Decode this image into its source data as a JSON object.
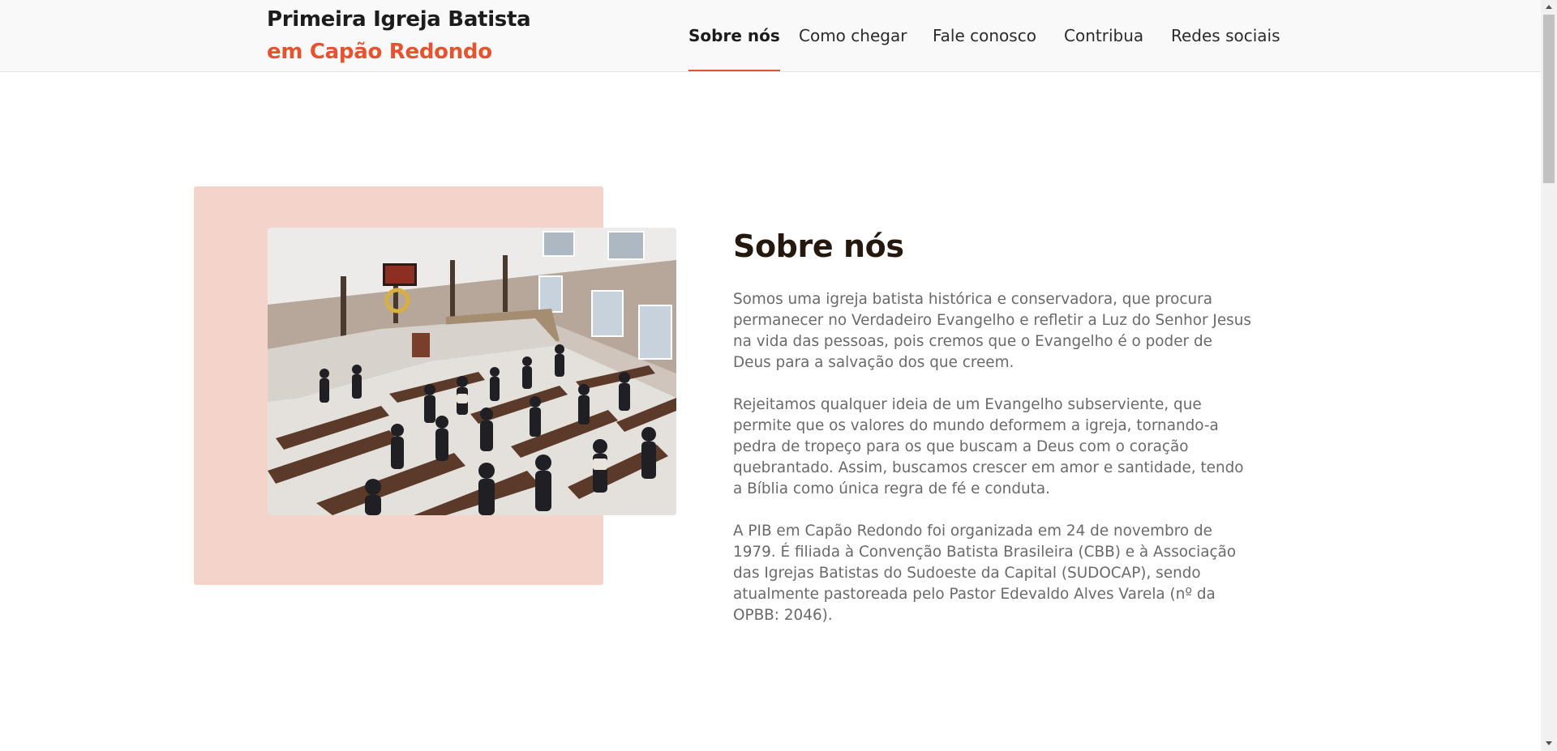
{
  "header": {
    "brand_line1": "Primeira Igreja Batista",
    "brand_line2": "em Capão Redondo",
    "nav": [
      {
        "label": "Sobre nós",
        "active": true
      },
      {
        "label": "Como chegar",
        "active": false
      },
      {
        "label": "Fale conosco",
        "active": false
      },
      {
        "label": "Contribua",
        "active": false
      },
      {
        "label": "Redes sociais",
        "active": false
      }
    ]
  },
  "about": {
    "title": "Sobre nós",
    "paragraphs": [
      "Somos uma igreja batista histórica e conservadora, que procura permanecer no Verdadeiro Evangelho e refletir a Luz do Senhor Jesus na vida das pessoas, pois cremos que o Evangelho é o poder de Deus para a salvação dos que creem.",
      "Rejeitamos qualquer ideia de um Evangelho subserviente, que permite que os valores do mundo deformem a igreja, tornando-a pedra de tropeço para os que buscam a Deus com o coração quebrantado. Assim, buscamos crescer em amor e santidade, tendo a Bíblia como única regra de fé e conduta.",
      "A PIB em Capão Redondo foi organizada em 24 de novembro de 1979. É filiada à Convenção Batista Brasileira (CBB) e à Associação das Igrejas Batistas do Sudoeste da Capital (SUDOCAP), sendo atualmente pastoreada pelo Pastor Edevaldo Alves Varela (nº da OPBB: 2046)."
    ]
  },
  "colors": {
    "accent": "#e8532f",
    "photo_backdrop": "#f4d3cb",
    "heading": "#24180f",
    "body_text": "#6a6a6a"
  }
}
